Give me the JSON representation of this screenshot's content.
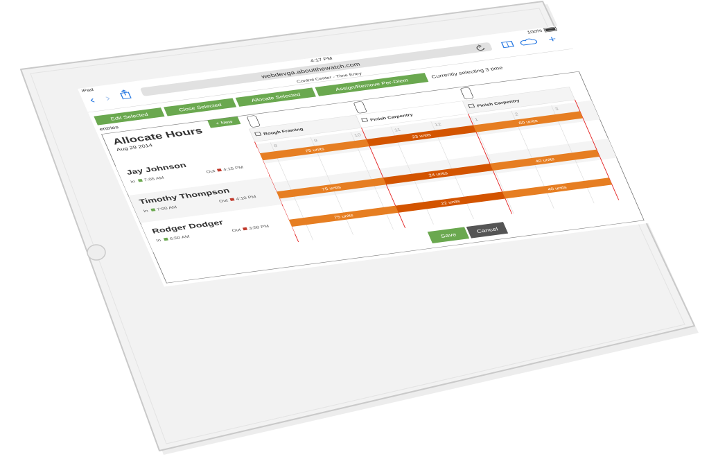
{
  "status_bar": {
    "carrier": "iPad",
    "time": "4:17 PM",
    "battery": "100%"
  },
  "browser": {
    "url": "webdevga.aboutthewatch.com",
    "page_title": "Control Center - Time Entry",
    "back_icon": "chevron-left-icon",
    "forward_icon": "chevron-right-icon",
    "share_icon": "share-icon",
    "reload_icon": "reload-icon",
    "bookmarks_icon": "book-icon",
    "cloud_icon": "cloud-icon",
    "new_tab_label": "+"
  },
  "toolbar": {
    "edit_label": "Edit Selected",
    "close_label": "Close Selected",
    "allocate_label": "Allocate Selected",
    "perdiem_label": "Assign/Remove Per-Diem",
    "status_text": "Currently selecting 3 time",
    "entries_text": "entries"
  },
  "panel": {
    "title": "Allocate Hours",
    "date": "Aug 29 2014",
    "new_label": "+ New"
  },
  "columns": [
    {
      "name": "Rough Framing"
    },
    {
      "name": "Finish Carpentry"
    },
    {
      "name": "Finish Carpentry"
    }
  ],
  "time_ticks": [
    "8",
    "9",
    "10",
    "11",
    "12",
    "1",
    "2",
    "3"
  ],
  "employees": [
    {
      "name": "Jay Johnson",
      "in_label": "In",
      "in_time": "7:05 AM",
      "out_label": "Out",
      "out_time": "4:15 PM"
    },
    {
      "name": "Timothy Thompson",
      "in_label": "In",
      "in_time": "7:00 AM",
      "out_label": "Out",
      "out_time": "4:10 PM"
    },
    {
      "name": "Rodger Dodger",
      "in_label": "In",
      "in_time": "6:50 AM",
      "out_label": "Out",
      "out_time": "3:50 PM"
    }
  ],
  "allocations": [
    {
      "label": "75 units"
    },
    {
      "label": "23 units"
    },
    {
      "label": "60 units"
    },
    {
      "label": "75 units"
    },
    {
      "label": "24 units"
    },
    {
      "label": "40 units"
    },
    {
      "label": "75 units"
    },
    {
      "label": "22 units"
    },
    {
      "label": "40 units"
    }
  ],
  "actions": {
    "save_label": "Save",
    "cancel_label": "Cancel"
  },
  "colors": {
    "green": "#6aa84f",
    "orange": "#e67e22",
    "dark_orange": "#d35400",
    "gray": "#555555",
    "red_line": "#e52b2b"
  }
}
